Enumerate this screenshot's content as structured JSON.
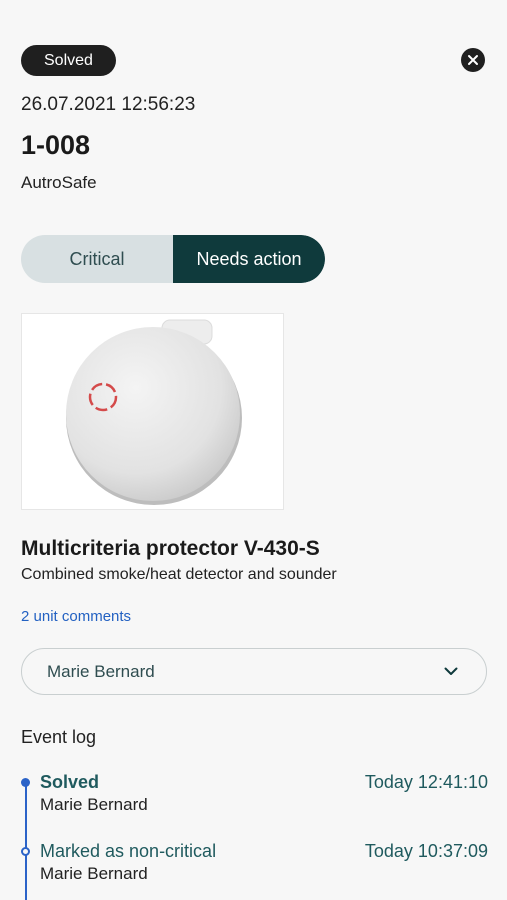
{
  "header": {
    "status": "Solved",
    "timestamp": "26.07.2021 12:56:23",
    "unit_id": "1-008",
    "system": "AutroSafe"
  },
  "segments": [
    {
      "label": "Critical",
      "active": false
    },
    {
      "label": "Needs action",
      "active": true
    }
  ],
  "product": {
    "name": "Multicriteria protector V-430-S",
    "description": "Combined smoke/heat detector and sounder",
    "comments_link": "2 unit comments"
  },
  "assignee": {
    "value": "Marie Bernard",
    "icon": "chevron-down-icon"
  },
  "event_log": {
    "heading": "Event log",
    "entries": [
      {
        "title": "Solved",
        "time": "Today 12:41:10",
        "user": "Marie Bernard"
      },
      {
        "title": "Marked as non-critical",
        "time": "Today 10:37:09",
        "user": "Marie Bernard"
      }
    ]
  },
  "colors": {
    "accent_dark": "#0f3a3c",
    "timeline_blue": "#2b63c8",
    "link_blue": "#2361c2"
  }
}
